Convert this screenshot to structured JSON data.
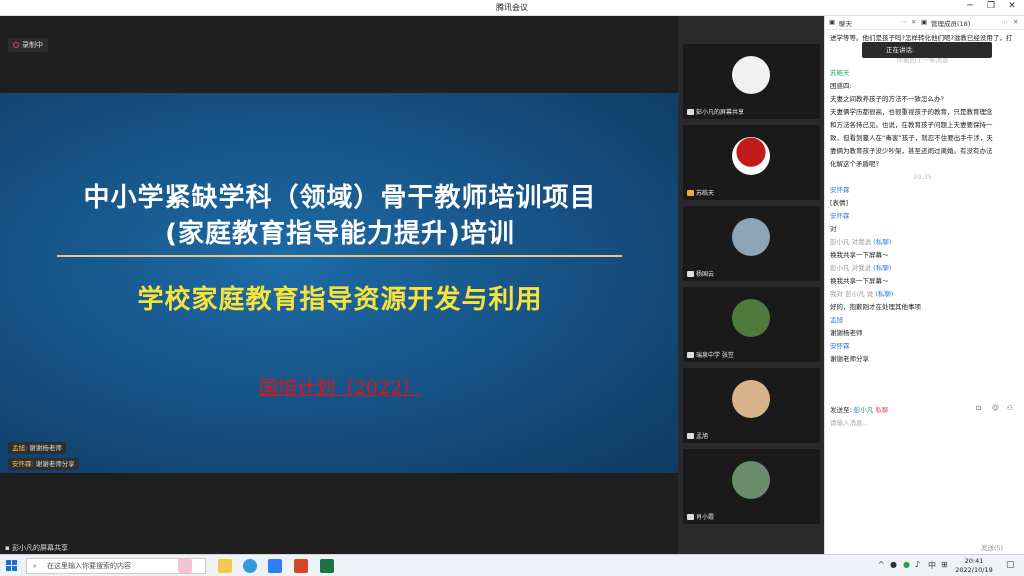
{
  "window": {
    "title": "腾讯会议"
  },
  "recording": {
    "label": "录制中"
  },
  "slide": {
    "line1": "中小学紧缺学科（领域）骨干教师培训项目",
    "line2": "(家庭教育指导能力提升)培训",
    "subtitle": "学校家庭教育指导资源开发与利用",
    "footer": "国培计划（2022）"
  },
  "bubbles": [
    {
      "name": "孟旭:",
      "text": "谢谢杨老师"
    },
    {
      "name": "安怀霖:",
      "text": "谢谢老师分享"
    }
  ],
  "share_label": "彭小凡的屏幕共享",
  "participants": [
    {
      "name": "彭小凡的屏幕共享",
      "color": "#f1f1f1"
    },
    {
      "name": "苏皓天",
      "color": "#c21a1a"
    },
    {
      "name": "杨国云",
      "color": "#8ca3b8"
    },
    {
      "name": "瑞泉中学 张笠",
      "color": "#4f7a3c"
    },
    {
      "name": "孟旭",
      "color": "#d7b48c"
    },
    {
      "name": "肖小霞",
      "color": "#6b8d6c"
    }
  ],
  "chat": {
    "tab_chat": "聊天",
    "tab_members": "管理成员(18)",
    "top_text": "进学等等。他们是孩子吗?怎样转化他们呢?滋教已经没用了，打",
    "typing": "正在讲话:",
    "fold_text": "你撤回了一条消息",
    "messages": [
      {
        "name": "苏皓天",
        "lines": [
          "困惑四:",
          "夫妻之间教养孩子的方法不一致怎么办?",
          "夫妻俩学历都很高，也很重视孩子的教育，只是教育理念",
          "和方法各持己见。也说，在教育孩子问题上夫妻要保持一",
          "致，但看到蔓人在“毒害”孩子，就忍不住要出手干涉，夫",
          "妻俩为教育孩子没少吵架，甚至还闹过离婚。有没有办法",
          "化解这个矛盾呢?"
        ]
      },
      {
        "time": "20:35"
      },
      {
        "name": "安怀霖",
        "lines": [
          "[表情]"
        ]
      },
      {
        "name": "安怀霖",
        "lines": [
          "对"
        ]
      },
      {
        "name": "彭小凡  对我说",
        "priv": "(私聊)",
        "lines": [
          "换我共享一下屏幕～"
        ]
      },
      {
        "name": "彭小凡  对我说",
        "priv": "(私聊)",
        "lines": [
          "换我共享一下屏幕～"
        ]
      },
      {
        "name": "我对  彭小凡  说",
        "priv": "(私聊)",
        "lines": [
          "好的，抱歉刚才在处理其他事项"
        ]
      },
      {
        "name": "孟旭",
        "lines": [
          "谢谢杨老师"
        ]
      },
      {
        "name": "安怀霖",
        "lines": [
          "谢谢老师分享"
        ]
      }
    ],
    "send_to_label": "发送至:",
    "send_to_name": "彭小凡",
    "send_to_priv": "私聊",
    "placeholder": "请输入消息...",
    "send_button": "发送(S)"
  },
  "taskbar": {
    "search_placeholder": "在这里输入你要搜索的内容",
    "ime": "中",
    "time": "20:41",
    "date": "2022/10/19"
  }
}
